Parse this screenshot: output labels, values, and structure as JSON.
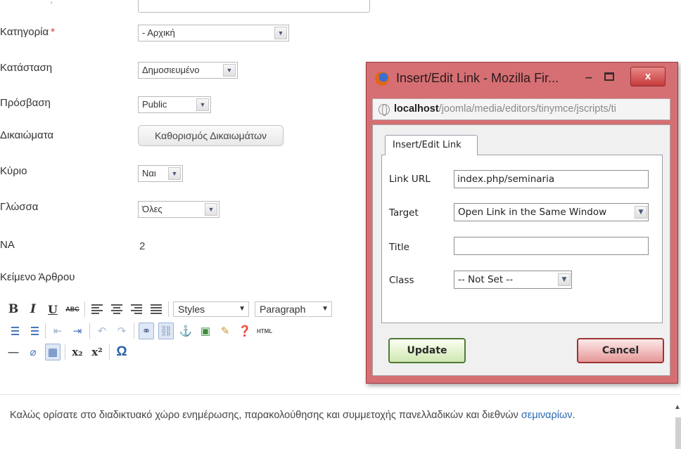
{
  "form": {
    "fields": [
      {
        "label": "Κατηγορία",
        "required_mark": "*",
        "value": "- Αρχική"
      },
      {
        "label": "Κατάσταση",
        "value": "Δημοσιευμένο"
      },
      {
        "label": "Πρόσβαση",
        "value": "Public"
      },
      {
        "label": "Δικαιώματα",
        "button": "Καθορισμός Δικαιωμάτων"
      },
      {
        "label": "Κύριο",
        "value": "Ναι"
      },
      {
        "label": "Γλώσσα",
        "value": "Όλες"
      },
      {
        "label": "ΝΑ",
        "value": "2"
      },
      {
        "label": "Κείμενο Άρθρου"
      }
    ]
  },
  "editor": {
    "row1": {
      "bold": "B",
      "italic": "I",
      "underline": "U",
      "strike": "ABC",
      "styles": "Styles",
      "paragraph": "Paragraph"
    },
    "row2": {
      "html_label": "HTML"
    },
    "row3": {
      "subscript": "x₂",
      "superscript": "x²",
      "omega": "Ω"
    },
    "content": {
      "text": "Καλώς ορίσατε στο διαδικτυακό χώρο ενημέρωσης, παρακολούθησης και συμμετοχής πανελλαδικών και διεθνών ",
      "link": "σεμιναρίων",
      "end": "."
    }
  },
  "dialog": {
    "title": "Insert/Edit Link - Mozilla Fir...",
    "close_glyph": "x",
    "url_host": "localhost",
    "url_path": "/joomla/media/editors/tinymce/jscripts/ti",
    "tab": "Insert/Edit Link",
    "fields": {
      "link_url_label": "Link URL",
      "link_url_value": "index.php/seminaria",
      "target_label": "Target",
      "target_value": "Open Link in the Same Window",
      "title_label": "Title",
      "title_value": "",
      "class_label": "Class",
      "class_value": "-- Not Set --"
    },
    "update_label": "Update",
    "cancel_label": "Cancel"
  }
}
